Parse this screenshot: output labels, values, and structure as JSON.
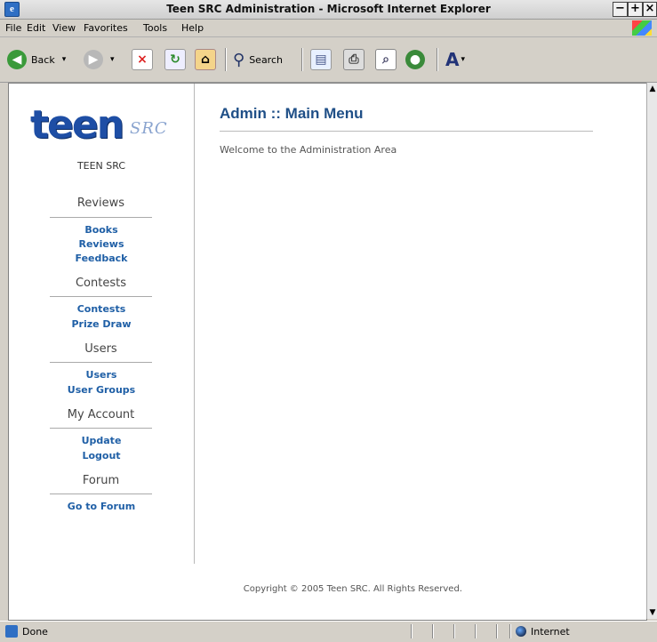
{
  "window": {
    "title": "Teen SRC Administration - Microsoft Internet Explorer"
  },
  "menu": [
    "File",
    "Edit",
    "View",
    "Favorites",
    "Tools",
    "Help"
  ],
  "toolbar": {
    "back_label": "Back",
    "search_label": "Search"
  },
  "site": {
    "logo_text": "teen",
    "logo_suffix": "SRC",
    "name": "TEEN SRC"
  },
  "sidebar": {
    "sections": [
      {
        "heading": "Reviews",
        "links": [
          "Books",
          "Reviews",
          "Feedback"
        ]
      },
      {
        "heading": "Contests",
        "links": [
          "Contests",
          "Prize Draw"
        ]
      },
      {
        "heading": "Users",
        "links": [
          "Users",
          "User Groups"
        ]
      },
      {
        "heading": "My Account",
        "links": [
          "Update",
          "Logout"
        ]
      },
      {
        "heading": "Forum",
        "links": [
          "Go to Forum"
        ]
      }
    ]
  },
  "main": {
    "title": "Admin :: Main Menu",
    "welcome": "Welcome to the Administration Area",
    "copyright": "Copyright © 2005 Teen SRC. All Rights Reserved."
  },
  "status": {
    "text": "Done",
    "zone": "Internet"
  }
}
